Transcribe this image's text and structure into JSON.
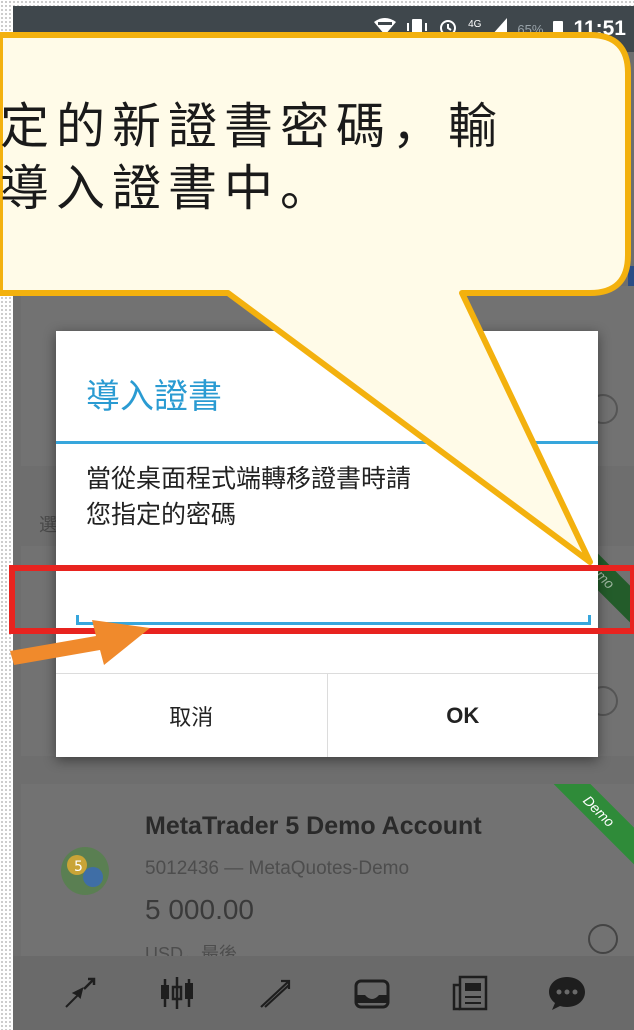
{
  "status_bar": {
    "icons": [
      "wifi-icon",
      "vibrate-icon",
      "alarm-icon",
      "signal-4g-icon",
      "battery-icon"
    ],
    "network": "4G",
    "battery": "65%",
    "time": "11:51"
  },
  "callout": {
    "line1": "定的新證書密碼，輸",
    "line2": "導入證書中。",
    "border_color": "#f3b10e"
  },
  "dialog": {
    "title": "導入證書",
    "message_line1": "當從桌面程式端轉移證書時請",
    "message_line2": "您指定的密碼",
    "password_value": "",
    "cancel_label": "取消",
    "ok_label": "OK",
    "accent_color": "#37a6dc"
  },
  "background": {
    "section_label": "選",
    "demo_badge": "Demo",
    "account": {
      "name": "MetaTrader 5 Demo Account",
      "number_server": "5012436 — MetaQuotes-Demo",
      "balance": "5 000.00",
      "currency_note": "USD，最後"
    }
  },
  "toolbar": {
    "items": [
      "quotes-icon",
      "chart-icon",
      "trade-icon",
      "history-icon",
      "news-icon",
      "chat-icon"
    ]
  },
  "highlight_color": "#e8231f",
  "arrow_color": "#f08a2c"
}
